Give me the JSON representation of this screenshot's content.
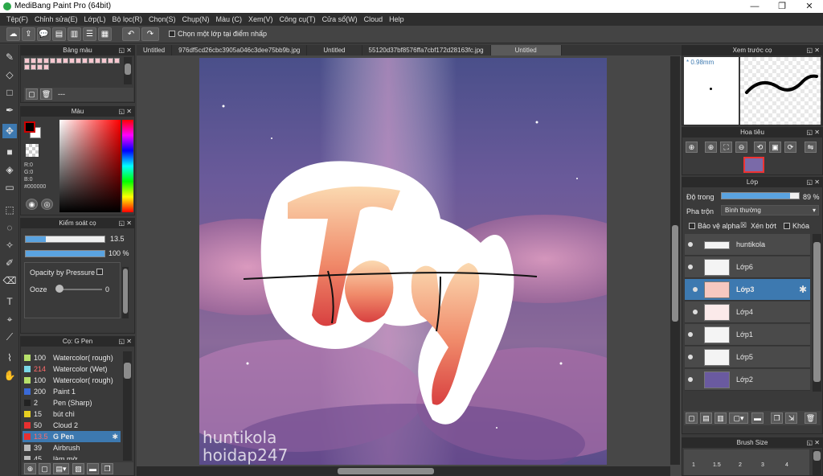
{
  "window": {
    "title": "MediBang Paint Pro (64bit)",
    "minimize": "—",
    "maximize": "❐",
    "close": "✕"
  },
  "menu": [
    "Tệp(F)",
    "Chỉnh sửa(E)",
    "Lớp(L)",
    "Bộ lọc(R)",
    "Chọn(S)",
    "Chụp(N)",
    "Màu (C)",
    "Xem(V)",
    "Công cụ(T)",
    "Cửa sổ(W)",
    "Cloud",
    "Help"
  ],
  "toolbar": {
    "select_layer_label": "Chọn một lớp tại điểm nhấp"
  },
  "palette": {
    "title": "Bảng màu",
    "placeholder": "---"
  },
  "color": {
    "title": "Màu",
    "r": "R:0",
    "g": "G:0",
    "b": "B:0",
    "hex": "#000000"
  },
  "brush_control": {
    "title": "Kiểm soát cọ",
    "size": "13.5",
    "opacity": "100 %",
    "opacity_pressure_label": "Opacity by Pressure",
    "ooze_label": "Ooze",
    "ooze_value": "0"
  },
  "brushes": {
    "title": "Cọ: G Pen",
    "items": [
      {
        "size": "100",
        "name": "Watercolor( rough)",
        "color": "#b6e06a"
      },
      {
        "size": "214",
        "name": "Watercolor (Wet)",
        "color": "#7ad8e6"
      },
      {
        "size": "100",
        "name": "Watercolor( rough)",
        "color": "#b6e06a"
      },
      {
        "size": "200",
        "name": "Paint 1",
        "color": "#3a6ad8"
      },
      {
        "size": "2",
        "name": "Pen (Sharp)",
        "color": "#222222"
      },
      {
        "size": "15",
        "name": "bút chì",
        "color": "#e8d020"
      },
      {
        "size": "50",
        "name": "Cloud 2",
        "color": "#e83030"
      },
      {
        "size": "13.5",
        "name": "G Pen",
        "color": "#e83030"
      },
      {
        "size": "39",
        "name": "Airbrush",
        "color": "#bbbbbb"
      },
      {
        "size": "45",
        "name": "làm mờ",
        "color": "#bbbbbb"
      }
    ]
  },
  "tabs": [
    "Untitled",
    "976df5cd26cbc3905a046c3dee75bb9b.jpg",
    "Untitled",
    "55120d37bf8576ffa7cbf172d28163fc.jpg",
    "Untitled"
  ],
  "artwork": {
    "watermark1": "huntikola",
    "watermark2": "hoidap247"
  },
  "preview": {
    "title": "Xem trước cọ",
    "size": "* 0.98mm"
  },
  "navigator": {
    "title": "Hoa tiêu"
  },
  "layers": {
    "title": "Lớp",
    "opacity_label": "Độ trong",
    "opacity_value": "89 %",
    "opacity_fraction": 0.89,
    "blend_label": "Pha trộn",
    "blend_value": "Bình thường",
    "protect_alpha": "Bảo vệ alpha",
    "clipping": "Xén bớt",
    "lock": "Khóa",
    "items": [
      {
        "name": "huntikola"
      },
      {
        "name": "Lớp6"
      },
      {
        "name": "Lớp3"
      },
      {
        "name": "Lớp4"
      },
      {
        "name": "Lớp1"
      },
      {
        "name": "Lớp5"
      },
      {
        "name": "Lớp2"
      }
    ]
  },
  "brush_size": {
    "title": "Brush Size",
    "sizes": [
      "1",
      "1.5",
      "2",
      "3",
      "4"
    ]
  }
}
